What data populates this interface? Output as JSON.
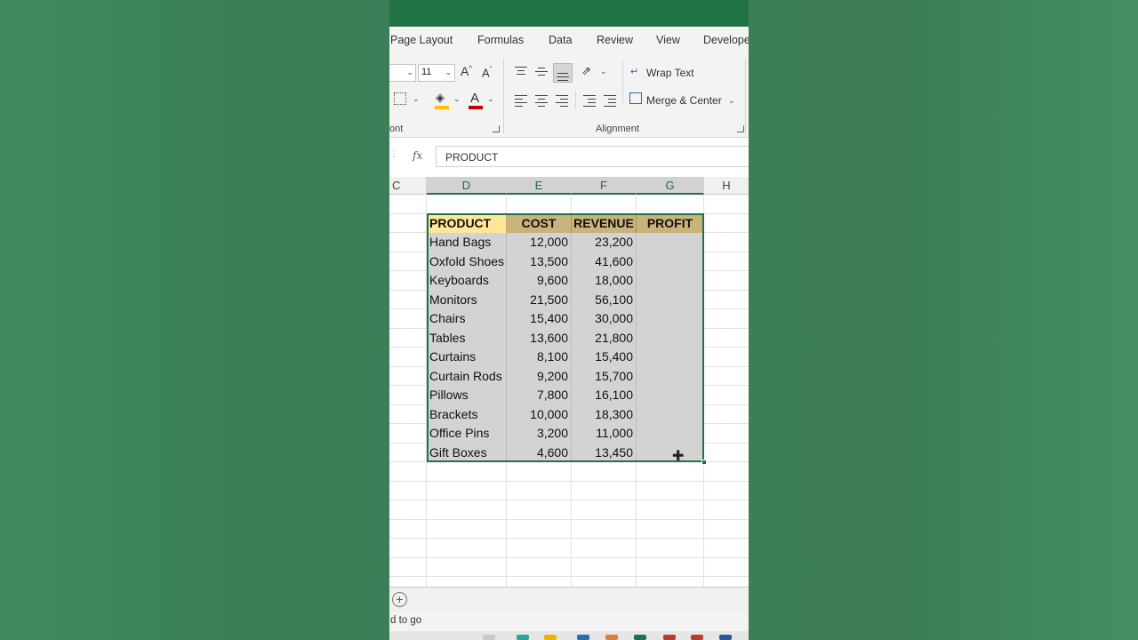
{
  "ribbon_tabs": [
    "Page Layout",
    "Formulas",
    "Data",
    "Review",
    "View",
    "Develope"
  ],
  "ribbon": {
    "font_size": "11",
    "wrap_text": "Wrap Text",
    "merge_center": "Merge & Center",
    "font_group_label": "ont",
    "alignment_group_label": "Alignment",
    "font_color": "#c00000",
    "fill_color": "#ffc000"
  },
  "formula_bar": {
    "fx": "fx",
    "value": "PRODUCT"
  },
  "columns": [
    "C",
    "D",
    "E",
    "F",
    "G",
    "H"
  ],
  "table": {
    "headers": [
      "PRODUCT",
      "COST",
      "REVENUE",
      "PROFIT"
    ],
    "rows": [
      [
        "Hand Bags",
        "12,000",
        "23,200",
        ""
      ],
      [
        "Oxfold Shoes",
        "13,500",
        "41,600",
        ""
      ],
      [
        "Keyboards",
        "9,600",
        "18,000",
        ""
      ],
      [
        "Monitors",
        "21,500",
        "56,100",
        ""
      ],
      [
        "Chairs",
        "15,400",
        "30,000",
        ""
      ],
      [
        "Tables",
        "13,600",
        "21,800",
        ""
      ],
      [
        "Curtains",
        "8,100",
        "15,400",
        ""
      ],
      [
        "Curtain Rods",
        "9,200",
        "15,700",
        ""
      ],
      [
        "Pillows",
        "7,800",
        "16,100",
        ""
      ],
      [
        "Brackets",
        "10,000",
        "18,300",
        ""
      ],
      [
        "Office Pins",
        "3,200",
        "11,000",
        ""
      ],
      [
        "Gift Boxes",
        "4,600",
        "13,450",
        ""
      ]
    ]
  },
  "status_bar": {
    "text": "d to go"
  },
  "colors": {
    "accent": "#217346",
    "header_yellow": "#ffe699",
    "header_gold": "#c9b37a",
    "selection_fill": "#d3d3d3"
  }
}
